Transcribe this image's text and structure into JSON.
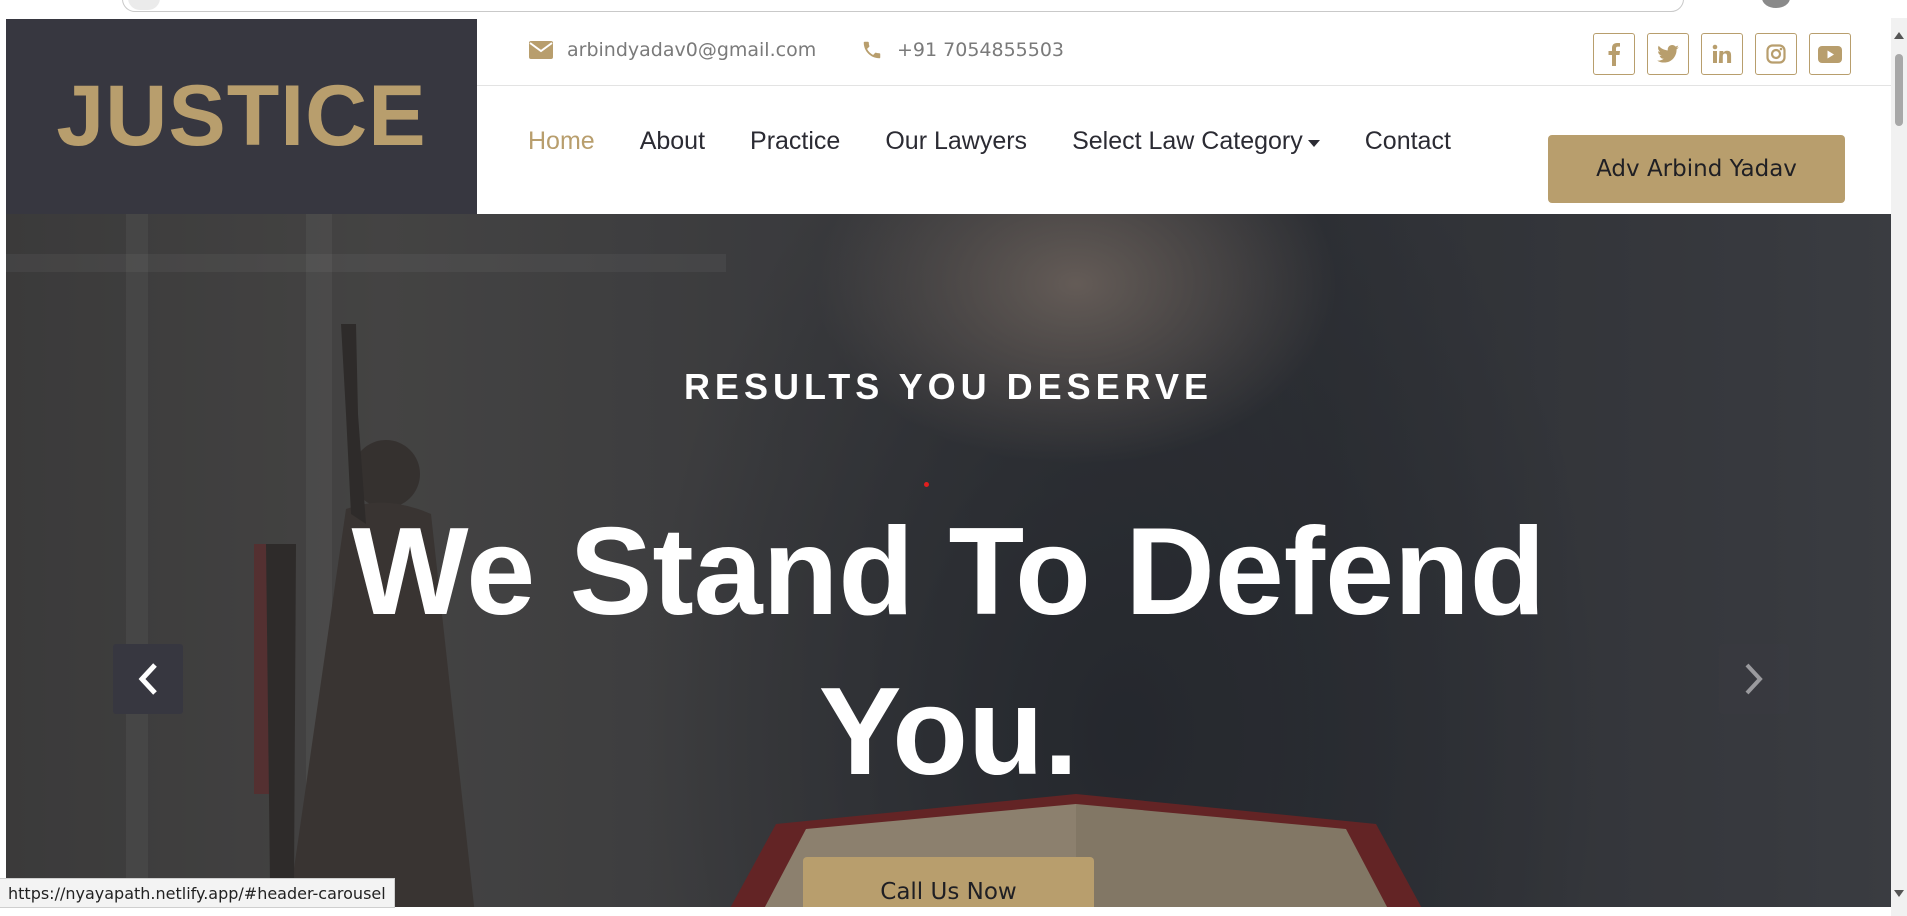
{
  "brand": {
    "logo_text": "JUSTICE"
  },
  "topbar": {
    "email": "arbindyadav0@gmail.com",
    "phone": "+91 7054855503",
    "socials": [
      "facebook-icon",
      "twitter-icon",
      "linkedin-icon",
      "instagram-icon",
      "youtube-icon"
    ]
  },
  "nav": {
    "items": [
      {
        "label": "Home",
        "active": true
      },
      {
        "label": "About"
      },
      {
        "label": "Practice"
      },
      {
        "label": "Our Lawyers"
      },
      {
        "label": "Select Law Category",
        "dropdown": true
      },
      {
        "label": "Contact"
      }
    ],
    "cta_label": "Adv Arbind Yadav"
  },
  "hero": {
    "kicker": "RESULTS YOU DESERVE",
    "headline_line1": "We Stand To Defend",
    "headline_line2": "You.",
    "cta_label": "Call Us Now"
  },
  "status_bar": {
    "url": "https://nyayapath.netlify.app/#header-carousel"
  },
  "colors": {
    "accent": "#b89e6d",
    "dark": "#373740",
    "text": "#2b2b33"
  }
}
